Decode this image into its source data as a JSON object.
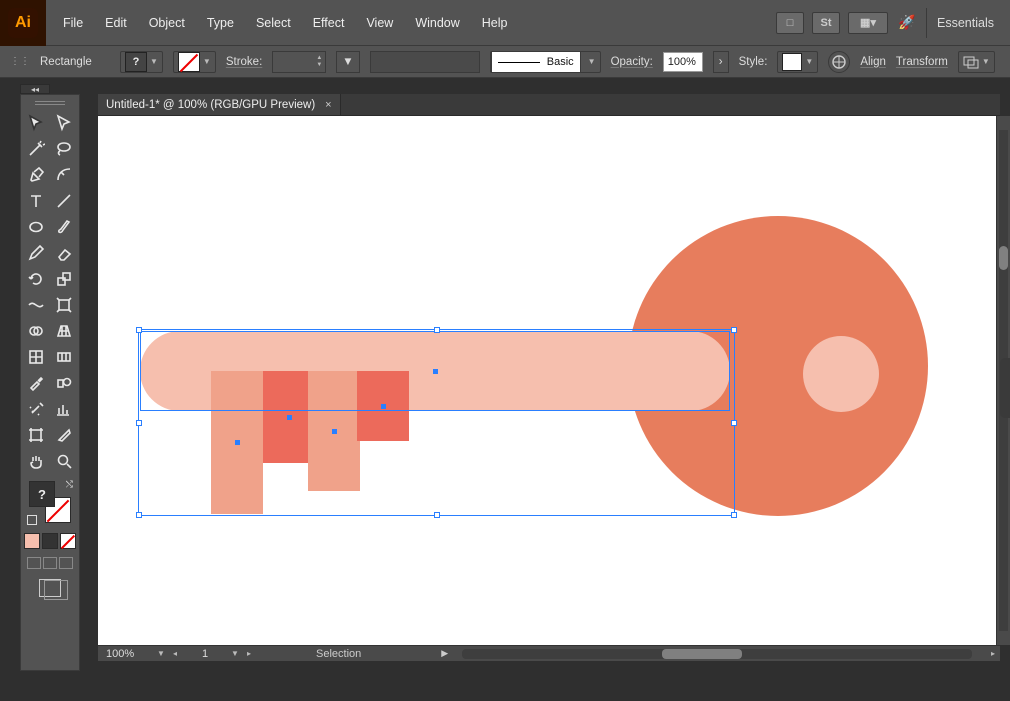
{
  "app": {
    "logo_text": "Ai",
    "workspace": "Essentials"
  },
  "menu": [
    "File",
    "Edit",
    "Object",
    "Type",
    "Select",
    "Effect",
    "View",
    "Window",
    "Help"
  ],
  "menubar_buttons": {
    "bridge": "□",
    "stock": "St",
    "layout": "▦▾",
    "gpu": "🚀"
  },
  "controlbar": {
    "shape_label": "Rectangle",
    "fill_swatch_text": "?",
    "stroke_label": "Stroke:",
    "brush_label": "Basic",
    "opacity_label": "Opacity:",
    "opacity_value": "100%",
    "style_label": "Style:",
    "align_label": "Align",
    "transform_label": "Transform"
  },
  "tab": {
    "title": "Untitled-1* @ 100% (RGB/GPU Preview)"
  },
  "toolbox": {
    "fill_swatch_text": "?",
    "swatch_colors": [
      "#f6bfae",
      "#333333"
    ]
  },
  "statusbar": {
    "zoom": "100%",
    "artboard": "1",
    "tool_label": "Selection"
  },
  "panel_collapse_glyph": "◂◂",
  "tools": [
    [
      "selection",
      "direct-selection"
    ],
    [
      "magic-wand",
      "lasso"
    ],
    [
      "pen",
      "curvature"
    ],
    [
      "type",
      "line"
    ],
    [
      "ellipse",
      "paintbrush"
    ],
    [
      "pencil",
      "eraser"
    ],
    [
      "rotate",
      "scale"
    ],
    [
      "width",
      "free-transform"
    ],
    [
      "shape-builder",
      "perspective"
    ],
    [
      "mesh",
      "gradient"
    ],
    [
      "eyedropper",
      "blend"
    ],
    [
      "symbol-sprayer",
      "column-graph"
    ],
    [
      "artboard",
      "slice"
    ],
    [
      "hand",
      "zoom"
    ]
  ]
}
